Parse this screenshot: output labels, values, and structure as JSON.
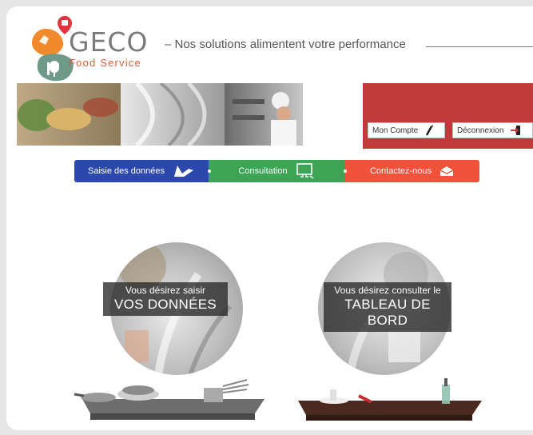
{
  "brand": {
    "name": "GECO",
    "subname": "Food Service",
    "tagline": "– Nos solutions alimentent votre performance"
  },
  "account": {
    "mon_compte": "Mon Compte",
    "deconnexion": "Déconnexion"
  },
  "nav": {
    "saisie": "Saisie des données",
    "consultation": "Consultation",
    "contact": "Contactez-nous"
  },
  "promos": {
    "saisie": {
      "line1": "Vous désirez saisir",
      "line2": "VOS DONNÉES"
    },
    "tableau": {
      "line1": "Vous désirez consulter le",
      "line2": "TABLEAU DE BORD"
    }
  },
  "colors": {
    "nav_blue": "#2d48ad",
    "nav_green": "#3ba455",
    "nav_orange": "#f1533a",
    "account_red": "#c13a3a"
  }
}
